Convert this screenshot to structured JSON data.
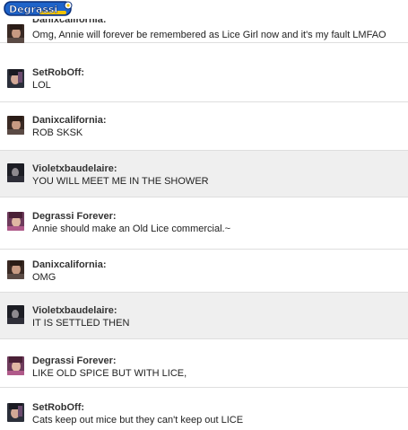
{
  "app": {
    "logo_text": "Degrassi",
    "logo_colors": {
      "primary": "#1e63c9",
      "outline": "#0b2f78",
      "accent": "#f2c300",
      "text_fill": "#ffffff"
    }
  },
  "messages": [
    {
      "user": "Danixcalifornia:",
      "text": "Omg, Annie will forever be remembered as Lice Girl now and it's my fault LMFAO",
      "shade": "plain",
      "avatar": "avatar-dani"
    },
    {
      "user": "SetRobOff:",
      "text": "LOL",
      "shade": "plain",
      "avatar": "avatar-rob"
    },
    {
      "user": "Danixcalifornia:",
      "text": "ROB SKSK",
      "shade": "plain",
      "avatar": "avatar-dani"
    },
    {
      "user": "Violetxbaudelaire:",
      "text": "YOU WILL MEET ME IN THE SHOWER",
      "shade": "alt",
      "avatar": "avatar-violet"
    },
    {
      "user": "Degrassi Forever:",
      "text": "Annie should make an Old Lice commercial.~",
      "shade": "plain",
      "avatar": "avatar-df"
    },
    {
      "user": "Danixcalifornia:",
      "text": "OMG",
      "shade": "plain",
      "avatar": "avatar-dani"
    },
    {
      "user": "Violetxbaudelaire:",
      "text": "IT IS SETTLED THEN",
      "shade": "alt",
      "avatar": "avatar-violet"
    },
    {
      "user": "Degrassi Forever:",
      "text": "LIKE OLD SPICE BUT WITH LICE,",
      "shade": "plain",
      "avatar": "avatar-df"
    },
    {
      "user": "SetRobOff:",
      "text": "Cats keep out mice but they can't keep out LICE",
      "shade": "plain",
      "avatar": "avatar-rob"
    }
  ]
}
